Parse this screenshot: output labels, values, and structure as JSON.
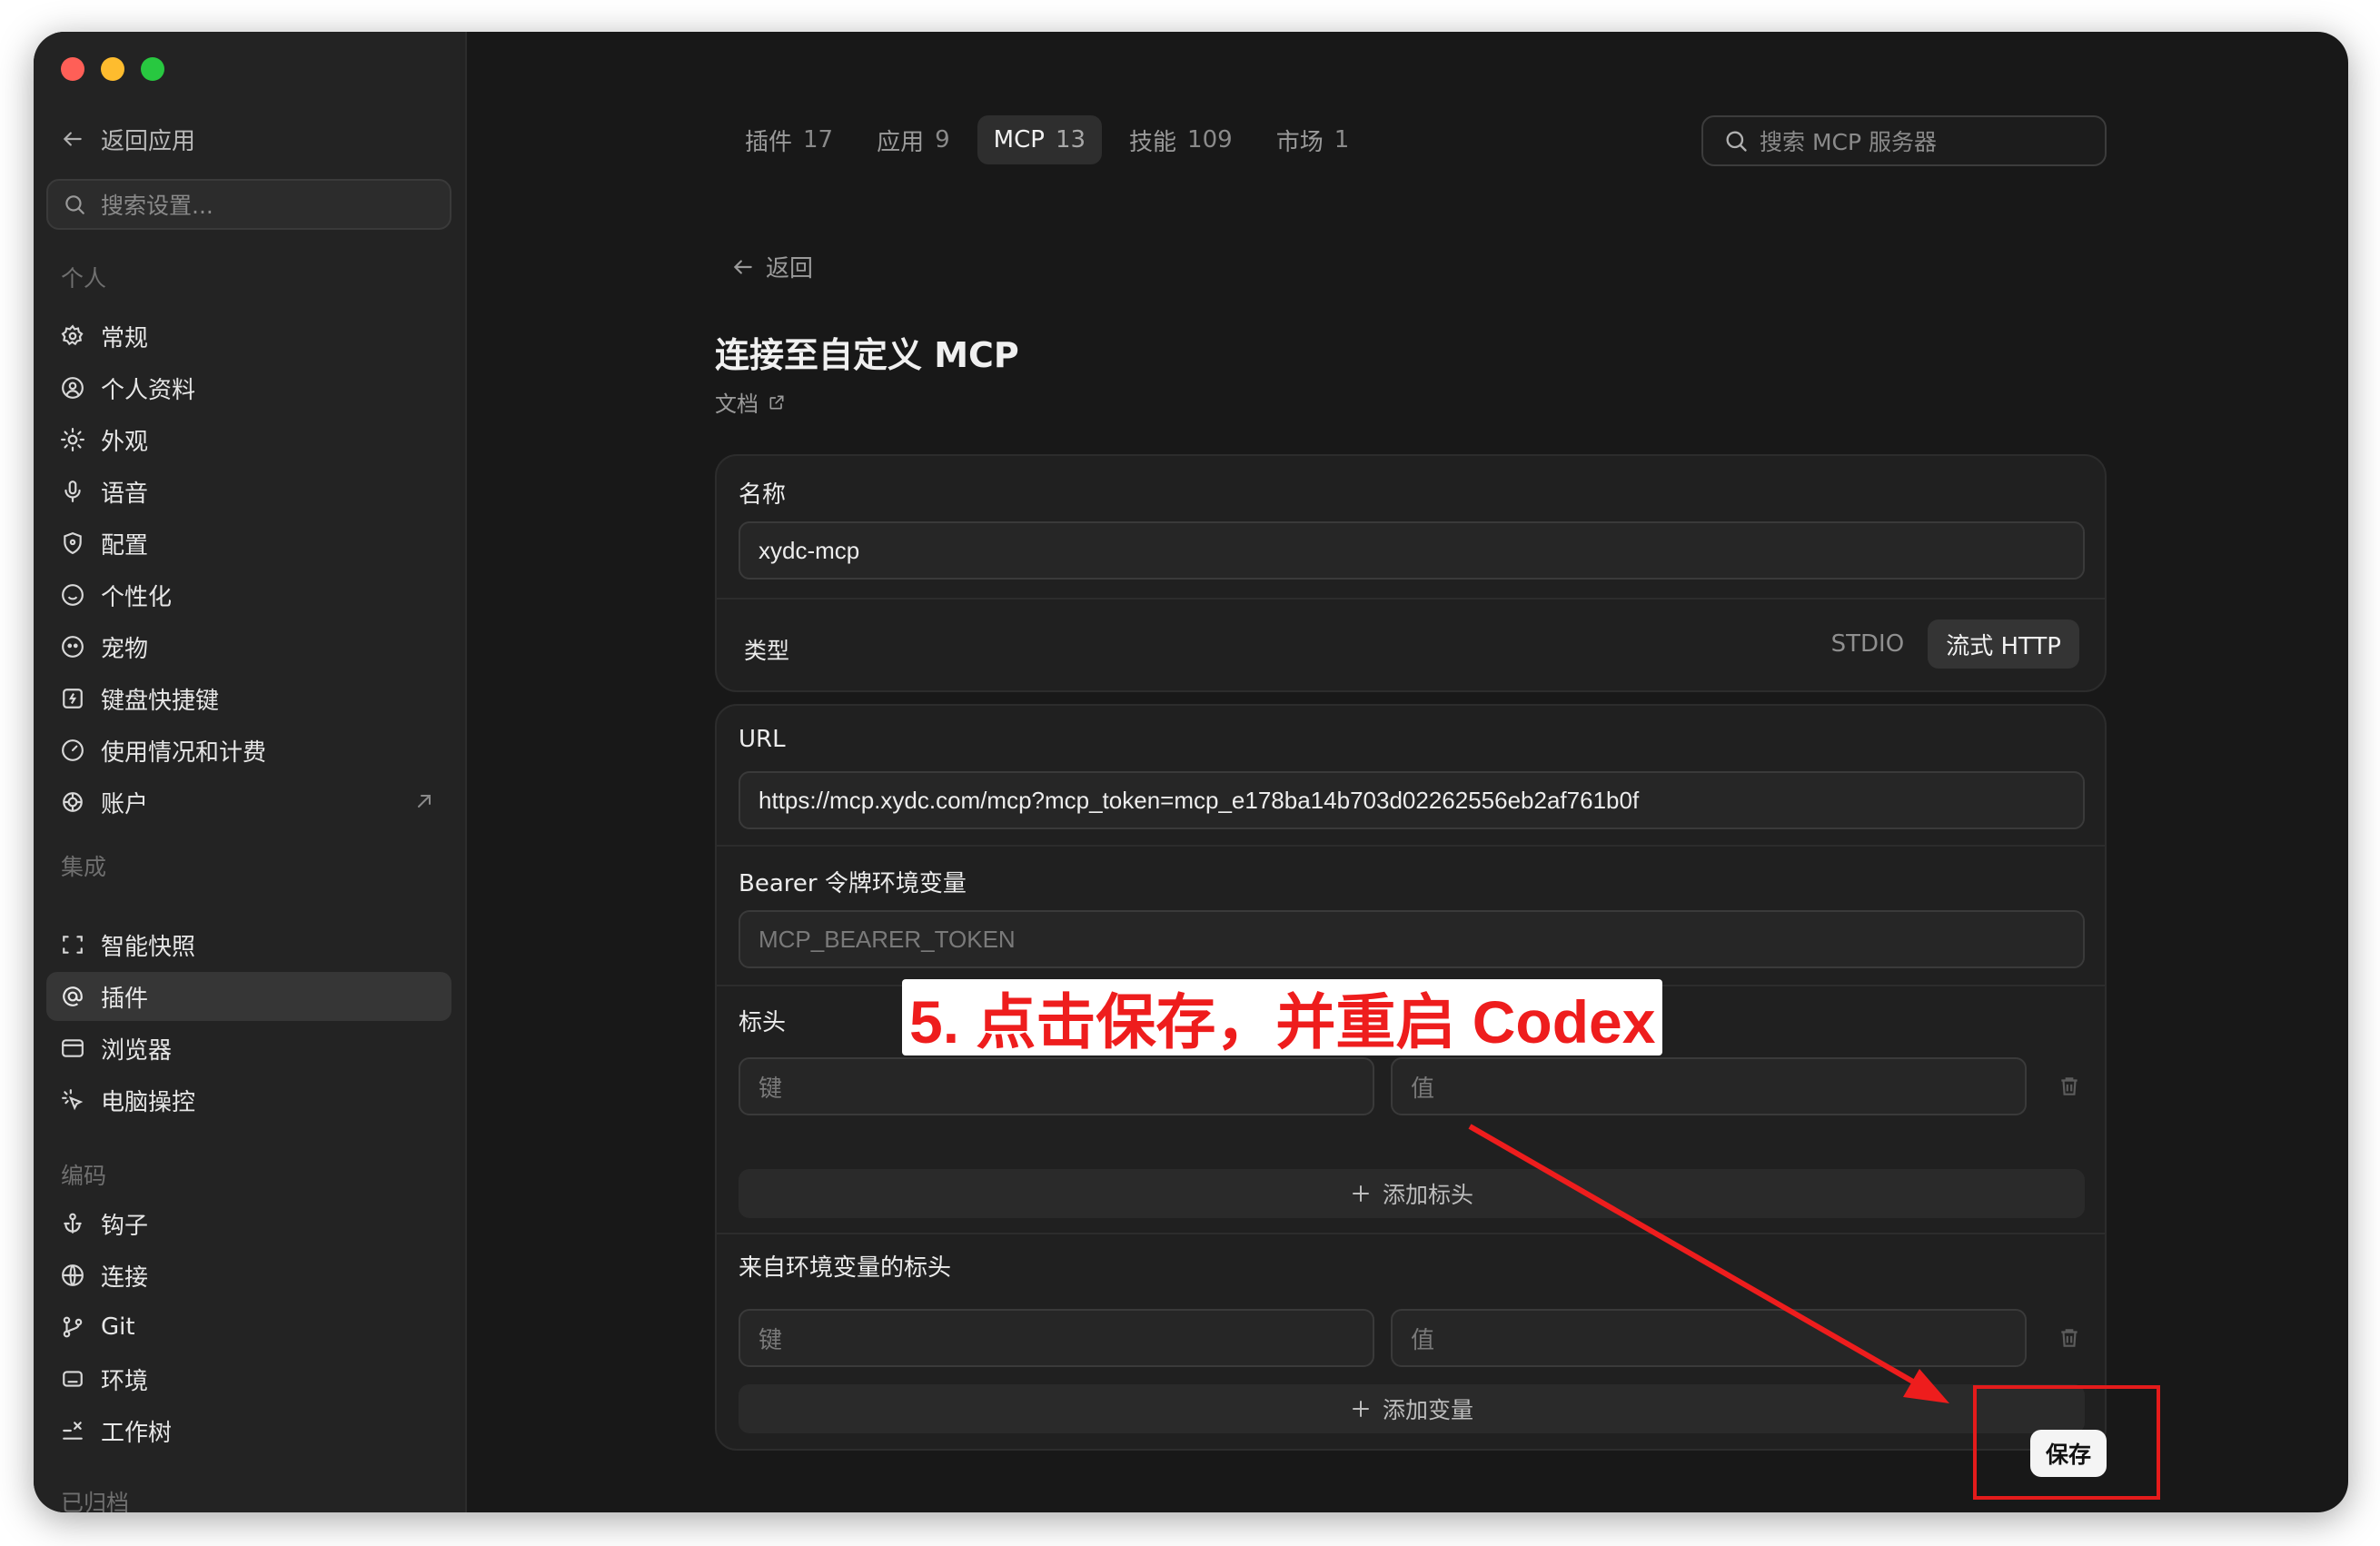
{
  "sidebar": {
    "back_label": "返回应用",
    "search_placeholder": "搜索设置...",
    "sections": {
      "personal": "个人",
      "integrations": "集成",
      "coding": "编码",
      "archived": "已归档"
    },
    "items": {
      "general": "常规",
      "profile": "个人资料",
      "appearance": "外观",
      "voice": "语音",
      "config": "配置",
      "personalization": "个性化",
      "pet": "宠物",
      "shortcuts": "键盘快捷键",
      "usage": "使用情况和计费",
      "account": "账户",
      "snapshot": "智能快照",
      "plugins": "插件",
      "browser": "浏览器",
      "computer_control": "电脑操控",
      "hooks": "钩子",
      "connections": "连接",
      "git": "Git",
      "environment": "环境",
      "worktree": "工作树"
    }
  },
  "tabs": [
    {
      "label": "插件",
      "count": "17"
    },
    {
      "label": "应用",
      "count": "9"
    },
    {
      "label": "MCP",
      "count": "13"
    },
    {
      "label": "技能",
      "count": "109"
    },
    {
      "label": "市场",
      "count": "1"
    }
  ],
  "main_search_placeholder": "搜索 MCP 服务器",
  "back_link": "返回",
  "title": "连接至自定义 MCP",
  "docs_link": "文档",
  "form": {
    "name_label": "名称",
    "name_value": "xydc-mcp",
    "type_label": "类型",
    "type_options": [
      "STDIO",
      "流式 HTTP"
    ],
    "type_selected": "流式 HTTP",
    "url_label": "URL",
    "url_value": "https://mcp.xydc.com/mcp?mcp_token=mcp_e178ba14b703d02262556eb2af761b0f",
    "bearer_label": "Bearer 令牌环境变量",
    "bearer_placeholder": "MCP_BEARER_TOKEN",
    "headers_label": "标头",
    "key_placeholder": "键",
    "value_placeholder": "值",
    "add_header": "添加标头",
    "env_headers_label": "来自环境变量的标头",
    "add_variable": "添加变量"
  },
  "save_label": "保存",
  "annotation_text": "5. 点击保存，并重启 Codex",
  "colors": {
    "window_bg": "#181818",
    "sidebar_bg": "#232323",
    "annotation_red": "#ee1d1d",
    "traffic_red": "#ff5f57",
    "traffic_yellow": "#febc2e",
    "traffic_green": "#28c840"
  }
}
